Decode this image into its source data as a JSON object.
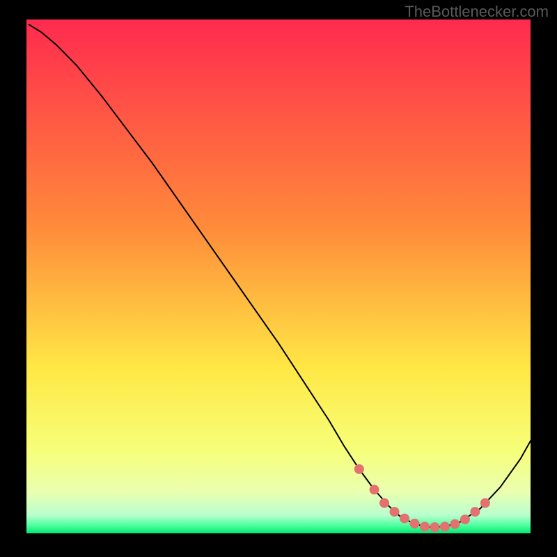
{
  "attribution": "TheBottlenecker.com",
  "chart_data": {
    "type": "line",
    "title": "",
    "xlabel": "",
    "ylabel": "",
    "xlim": [
      0,
      100
    ],
    "ylim": [
      0,
      100
    ],
    "gradient_stops": [
      {
        "offset": 0.0,
        "color": "#ff2a4e"
      },
      {
        "offset": 0.4,
        "color": "#ff8a3a"
      },
      {
        "offset": 0.68,
        "color": "#ffe845"
      },
      {
        "offset": 0.84,
        "color": "#f6ff7a"
      },
      {
        "offset": 0.92,
        "color": "#eaffb0"
      },
      {
        "offset": 0.965,
        "color": "#b8ffcf"
      },
      {
        "offset": 0.985,
        "color": "#4cff9e"
      },
      {
        "offset": 1.0,
        "color": "#00e870"
      }
    ],
    "series": [
      {
        "name": "bottleneck-curve",
        "type": "line",
        "color": "#000000",
        "width": 2,
        "x": [
          0.5,
          3,
          6,
          10,
          15,
          20,
          25,
          30,
          35,
          40,
          45,
          50,
          55,
          60,
          63,
          66,
          69,
          72,
          74,
          77,
          80,
          83,
          86,
          90,
          94,
          98,
          100
        ],
        "y": [
          99,
          97.5,
          95,
          91,
          85,
          78.5,
          72,
          65,
          58,
          51,
          44,
          37,
          29.5,
          22,
          17,
          12.5,
          8.5,
          5.2,
          3.4,
          1.8,
          1.2,
          1.3,
          2.2,
          4.8,
          9,
          14.5,
          18
        ]
      },
      {
        "name": "optimal-zone-markers",
        "type": "scatter",
        "color": "#e2716f",
        "radius": 7,
        "x": [
          66,
          69,
          71,
          73,
          75,
          77,
          79,
          81,
          83,
          85,
          87,
          89,
          91
        ],
        "y": [
          12.5,
          8.5,
          5.9,
          4.2,
          2.9,
          1.9,
          1.3,
          1.2,
          1.3,
          1.8,
          2.7,
          4.2,
          5.9
        ]
      }
    ]
  }
}
